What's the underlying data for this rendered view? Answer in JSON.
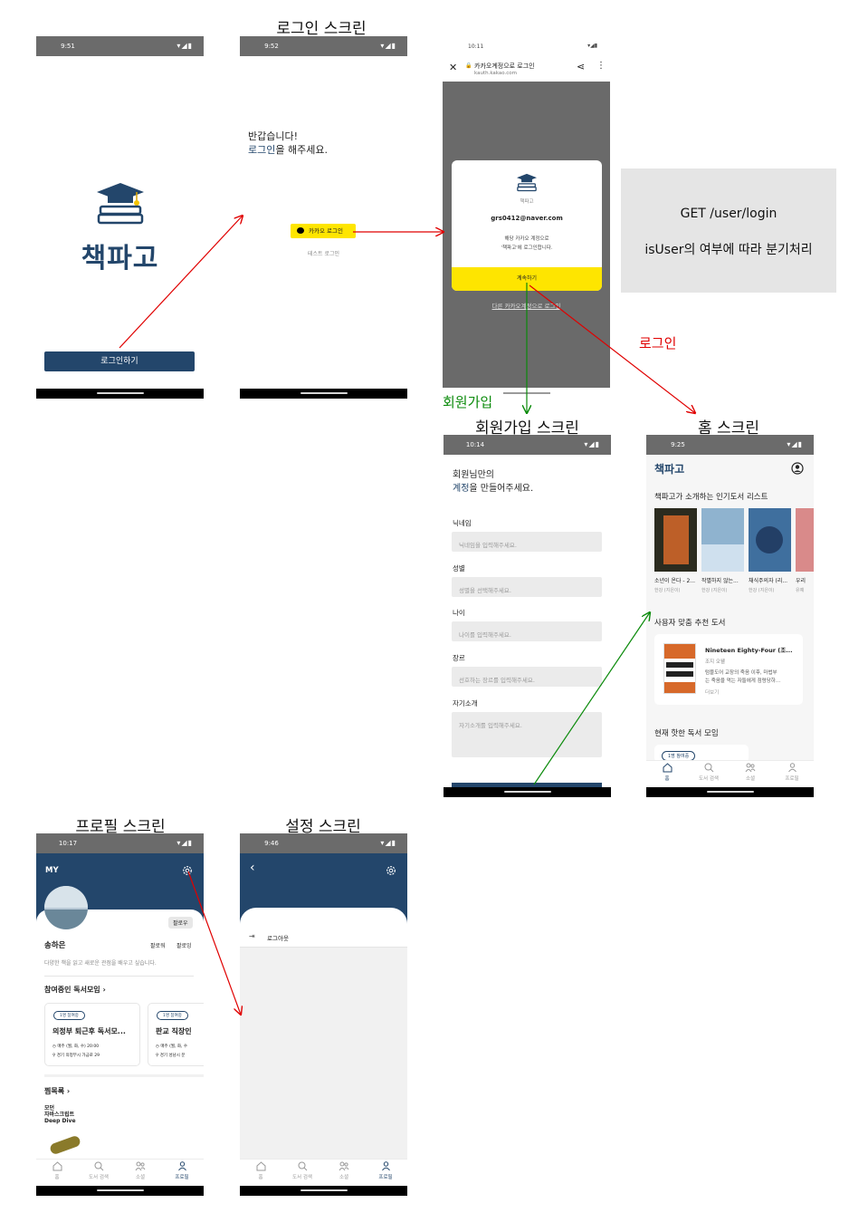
{
  "captions": {
    "login_screen": "로그인 스크린",
    "signup_screen": "회원가입 스크린",
    "home_screen": "홈 스크린",
    "profile_screen": "프로필 스크린",
    "settings_screen": "설정 스크린"
  },
  "edges": {
    "signup_label": "회원가입",
    "login_label": "로그인"
  },
  "note": {
    "line1": "GET /user/login",
    "line2": "isUser의 여부에 따라 분기처리"
  },
  "splash": {
    "time": "9:51",
    "logo_text": "책파고",
    "login_button": "로그인하기"
  },
  "login": {
    "time": "9:52",
    "greeting": "반갑습니다!",
    "prompt_highlight": "로그인",
    "prompt_rest": "을 해주세요.",
    "kakao_button": "카카오 로그인",
    "test_login": "테스트 로그인"
  },
  "kakao": {
    "time": "10:11",
    "title": "카카오계정으로 로그인",
    "url": "kauth.kakao.com",
    "service_name": "책파고",
    "email": "grs0412@naver.com",
    "message_line1": "해당 카카오 계정으로",
    "message_line2": "'책파고'에 로그인합니다.",
    "continue_button": "계속하기",
    "other_account": "다른 카카오계정으로 로그인"
  },
  "signup": {
    "time": "10:14",
    "title_line1": "회원님만의",
    "title_highlight": "계정",
    "title_rest": "을 만들어주세요.",
    "fields": [
      {
        "label": "닉네임",
        "placeholder": "닉네임을 입력해주세요."
      },
      {
        "label": "성별",
        "placeholder": "성별을 선택해주세요."
      },
      {
        "label": "나이",
        "placeholder": "나이를 입력해주세요."
      },
      {
        "label": "장르",
        "placeholder": "선호하는 장르를 입력해주세요."
      },
      {
        "label": "자기소개",
        "placeholder": "자기소개를 입력해주세요."
      }
    ]
  },
  "home": {
    "time": "9:25",
    "logo": "책파고",
    "section_popular": "책파고가 소개하는 인기도서 리스트",
    "books": [
      {
        "title": "소년이 온다 - 2...",
        "author": "한강 (지은이)",
        "color": "#2b2b1f"
      },
      {
        "title": "작별하지 않는...",
        "author": "한강 (지은이)",
        "color": "#8fb3cf"
      },
      {
        "title": "채식주의자 (리...",
        "author": "한강 (지은이)",
        "color": "#3f6f9e"
      },
      {
        "title": "우리",
        "author": "유예",
        "color": "#d98a8a"
      }
    ],
    "section_recommend": "사용자 맞춤 추천 도서",
    "rec_title": "Nineteen Eighty-Four (조...",
    "rec_author": "조지 오웰",
    "rec_desc_line1": "텀블도어 교장의 죽음 이후, 마법부",
    "rec_desc_line2": "는 죽음을 먹는 자들에게 점령당하...",
    "rec_more": "더보기",
    "section_meetings": "현재 핫한 독서 모임",
    "meeting_badge": "1명 참여중"
  },
  "tabs": [
    "홈",
    "도서 검색",
    "소셜",
    "프로필"
  ],
  "profile": {
    "time": "10:17",
    "header": "MY",
    "follow_button": "팔로우",
    "name": "송하은",
    "followers": "팔로워",
    "following": "팔로잉",
    "bio": "다양한 책을 읽고 새로운 관점을 배우고 싶습니다.",
    "section_meetings": "참여중인 독서모임",
    "meetings": [
      {
        "badge": "1명 참여중",
        "title": "의정부 퇴근후 독서모...",
        "schedule": "매주 (월, 화, 수) 20:00",
        "location": "경기 의정부시 가금로 29"
      },
      {
        "badge": "1명 참여중",
        "title": "판교 직장인",
        "schedule": "매주 (월, 화, 수",
        "location": "경기 성남시 분"
      }
    ],
    "section_wishlist": "찜목록",
    "wish_book_line1": "모던",
    "wish_book_line2": "자바스크립트",
    "wish_book_line3": "Deep Dive"
  },
  "settings": {
    "time": "9:46",
    "logout": "로그아웃"
  },
  "colors": {
    "navy": "#23466b",
    "kakao_yellow": "#fee500",
    "arrow_red": "#e00000",
    "arrow_green": "#0a8a0a",
    "status_gray": "#6b6b6b"
  }
}
